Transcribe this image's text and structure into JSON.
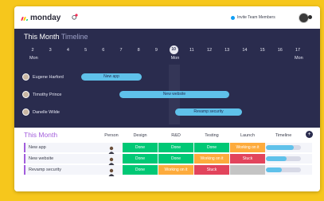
{
  "app": {
    "brand": "monday",
    "invite_label": "Invite Team Members"
  },
  "timeline": {
    "title": "This Month",
    "subtitle": "Timeline",
    "days": [
      "2",
      "3",
      "4",
      "5",
      "6",
      "7",
      "8",
      "9",
      "10",
      "11",
      "12",
      "13",
      "14",
      "15",
      "16",
      "17"
    ],
    "day_sub": [
      "Mon",
      "Mon",
      "Mon"
    ],
    "today": "10",
    "people": [
      {
        "name": "Eugene Harford",
        "bar": "New app"
      },
      {
        "name": "Timothy Prince",
        "bar": "New website"
      },
      {
        "name": "Danelle Wilde",
        "bar": "Revamp security"
      }
    ]
  },
  "board": {
    "group_title": "This Month",
    "columns": [
      "Person",
      "Design",
      "R&D",
      "Testing",
      "Launch",
      "Timeline"
    ],
    "rows": [
      {
        "name": "New app",
        "design": "Done",
        "rnd": "Done",
        "testing": "Done",
        "launch": "Working on it",
        "timeline_progress": 0.8
      },
      {
        "name": "New website",
        "design": "Done",
        "rnd": "Done",
        "testing": "Working on it",
        "launch": "Stuck",
        "timeline_progress": 0.6
      },
      {
        "name": "Revamp security",
        "design": "Done",
        "rnd": "Working on it",
        "testing": "Stuck",
        "launch": "",
        "timeline_progress": 0.45
      }
    ]
  },
  "colors": {
    "done": "#00c875",
    "working": "#fdab3d",
    "stuck": "#e2445c",
    "empty": "#c4c4c4",
    "group": "#a25ddc",
    "timeline_bg": "#2a2c4e",
    "bar": "#5fc1ea"
  }
}
